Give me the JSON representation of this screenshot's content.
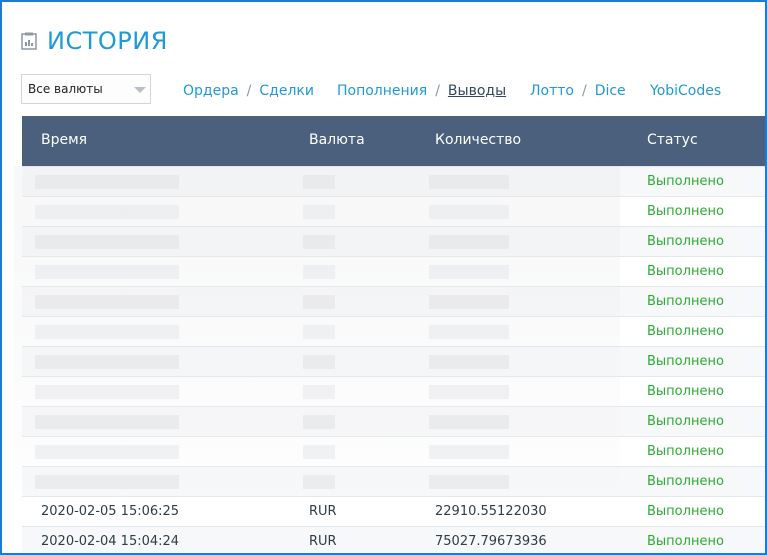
{
  "page": {
    "title": "ИСТОРИЯ",
    "title_icon": "document-chart-icon"
  },
  "filter": {
    "selected": "Все валюты"
  },
  "nav": {
    "orders": "Ордера",
    "deals": "Сделки",
    "deposits": "Пополнения",
    "withdrawals": "Выводы",
    "lotto": "Лотто",
    "dice": "Dice",
    "yobicodes": "YobiCodes",
    "separator": "/"
  },
  "table": {
    "headers": {
      "time": "Время",
      "currency": "Валюта",
      "amount": "Количество",
      "status": "Статус"
    },
    "rows": [
      {
        "time": "",
        "currency": "",
        "amount": "",
        "status": "Выполнено"
      },
      {
        "time": "",
        "currency": "",
        "amount": "",
        "status": "Выполнено"
      },
      {
        "time": "",
        "currency": "",
        "amount": "",
        "status": "Выполнено"
      },
      {
        "time": "",
        "currency": "",
        "amount": "",
        "status": "Выполнено"
      },
      {
        "time": "",
        "currency": "",
        "amount": "",
        "status": "Выполнено"
      },
      {
        "time": "",
        "currency": "",
        "amount": "",
        "status": "Выполнено"
      },
      {
        "time": "",
        "currency": "",
        "amount": "",
        "status": "Выполнено"
      },
      {
        "time": "",
        "currency": "",
        "amount": "",
        "status": "Выполнено"
      },
      {
        "time": "",
        "currency": "",
        "amount": "",
        "status": "Выполнено"
      },
      {
        "time": "",
        "currency": "",
        "amount": "",
        "status": "Выполнено"
      },
      {
        "time": "",
        "currency": "",
        "amount": "",
        "status": "Выполнено"
      },
      {
        "time": "2020-02-05 15:06:25",
        "currency": "RUR",
        "amount": "22910.55122030",
        "status": "Выполнено"
      },
      {
        "time": "2020-02-04 15:04:24",
        "currency": "RUR",
        "amount": "75027.79673936",
        "status": "Выполнено"
      }
    ]
  },
  "colors": {
    "accent": "#1f9ad6",
    "header_bg": "#4a607c",
    "status_done": "#2eaa36",
    "frame": "#1c7bd4"
  }
}
